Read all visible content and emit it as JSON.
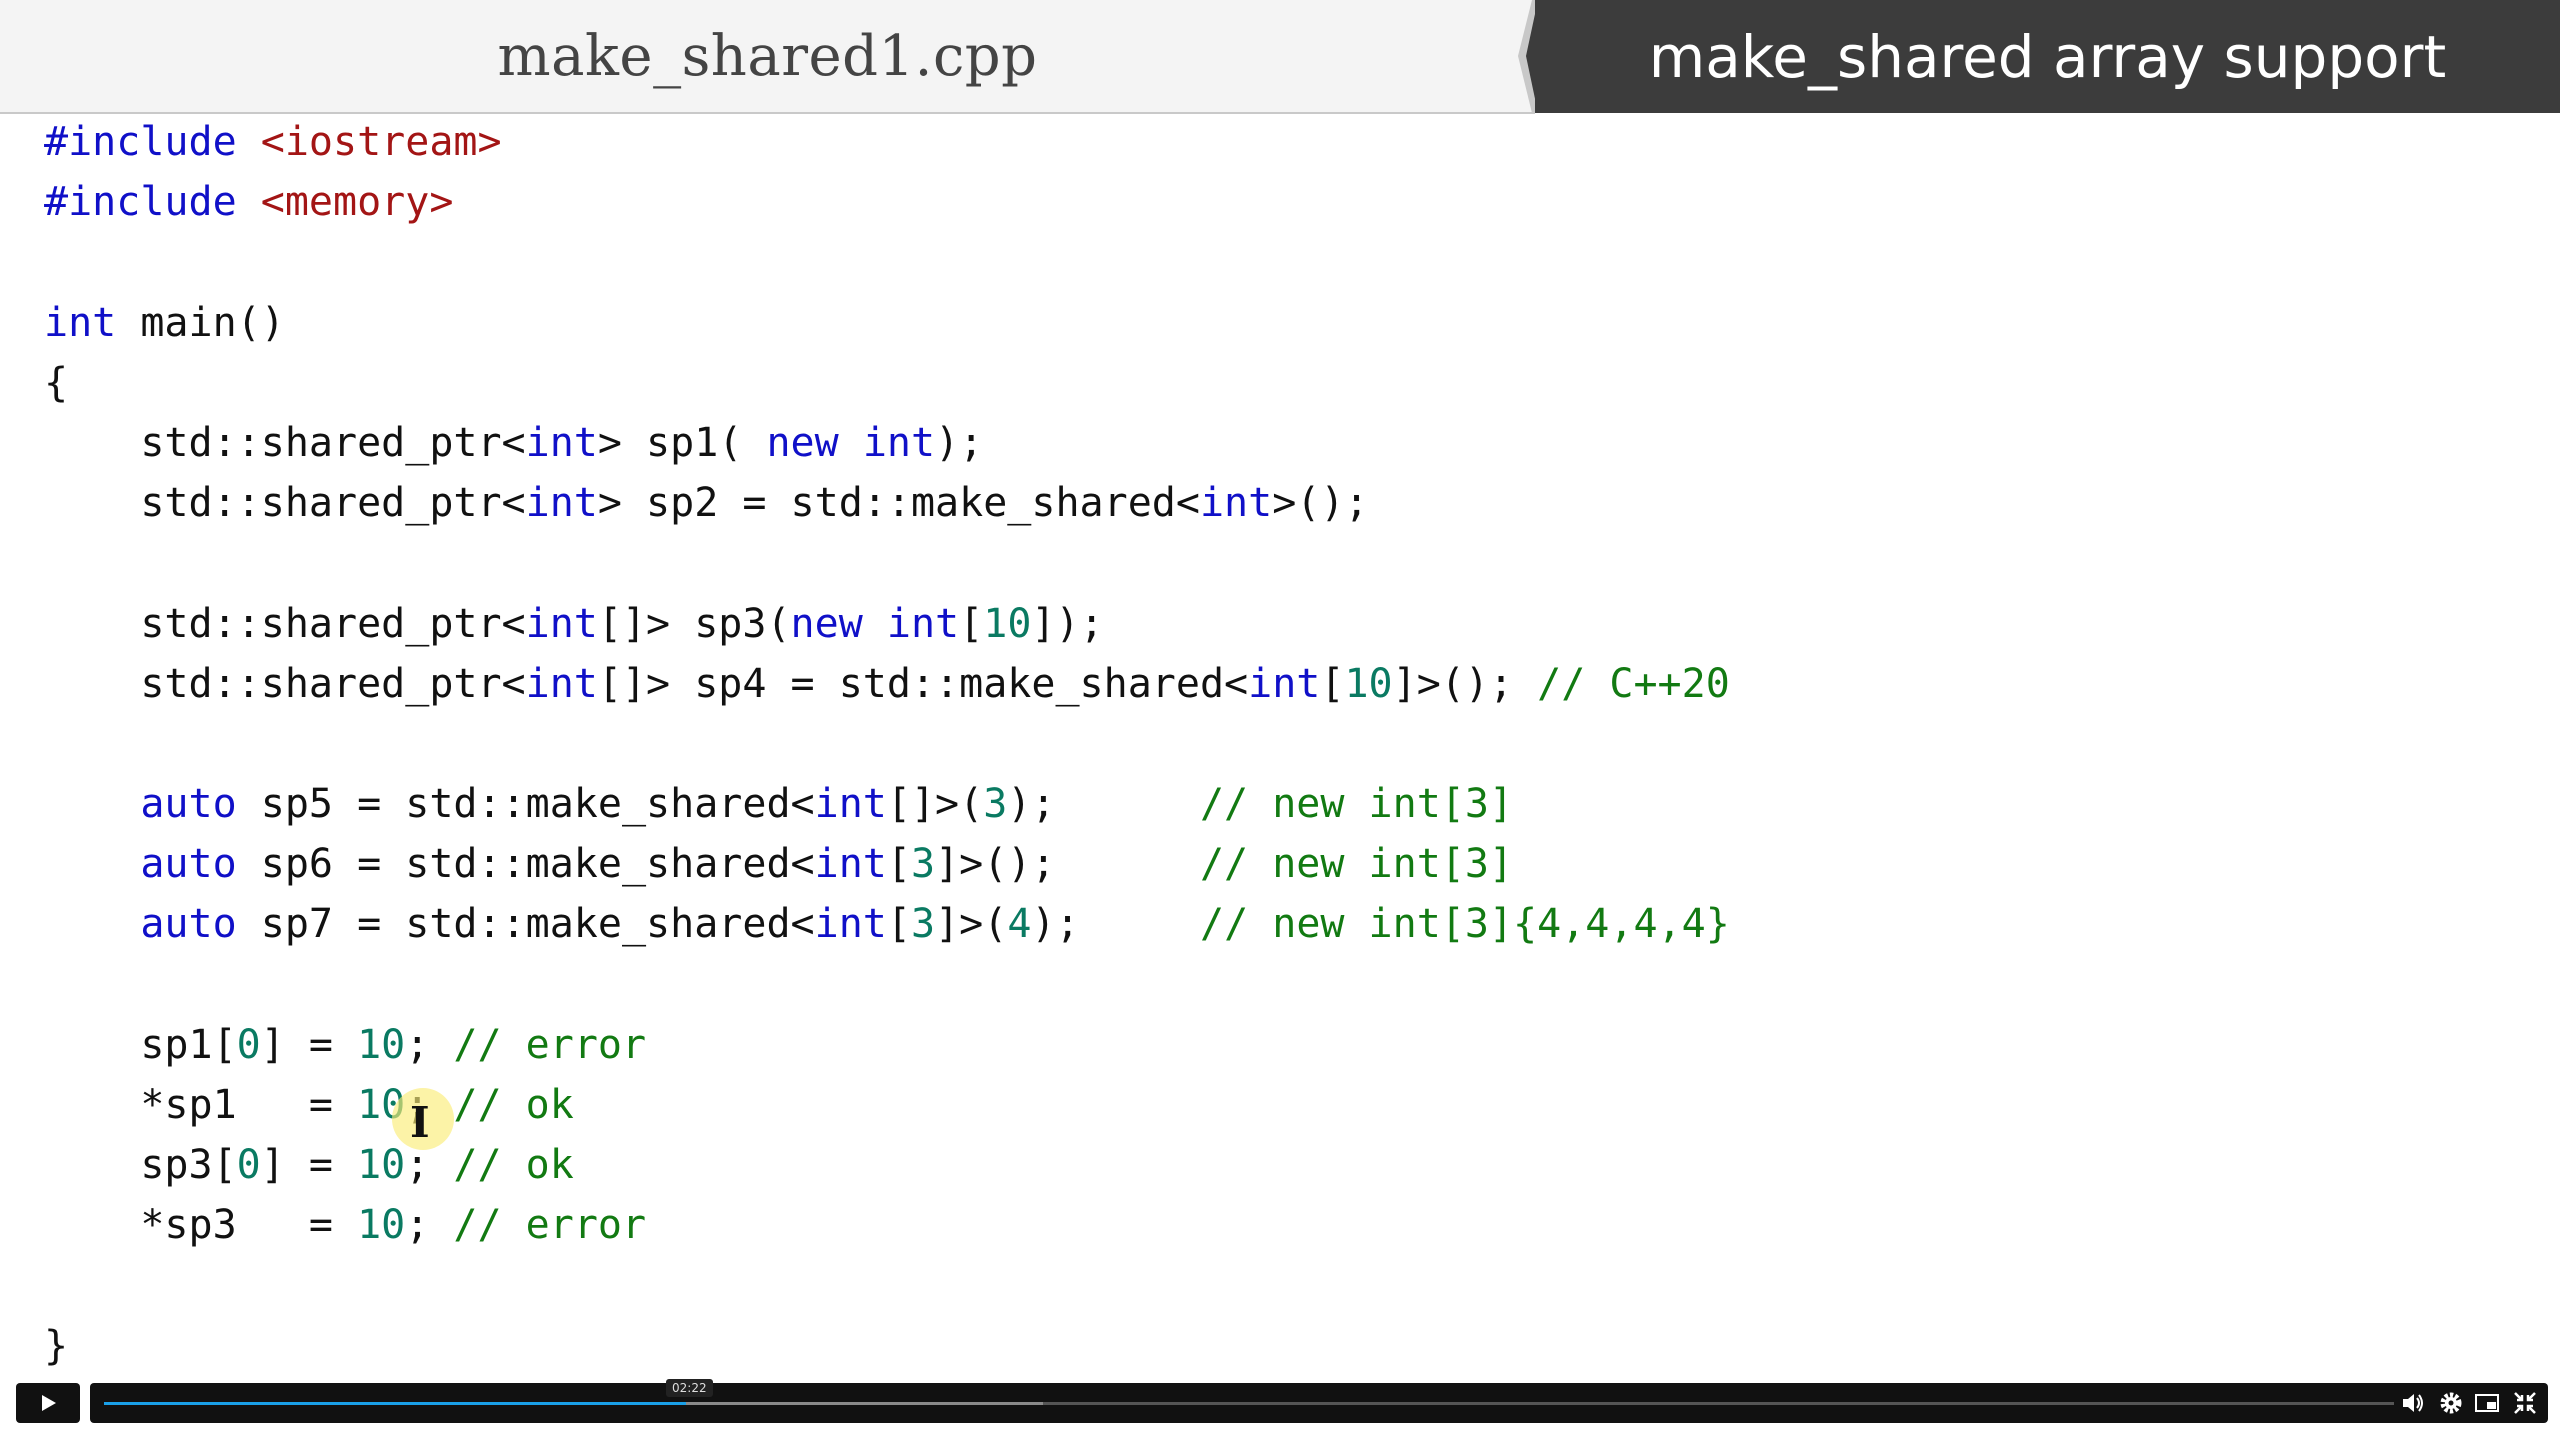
{
  "header": {
    "file_name": "make_shared1.cpp",
    "topic_title": "make_shared array support"
  },
  "code_lines": [
    [
      {
        "t": "#include ",
        "c": "k"
      },
      {
        "t": "<iostream>",
        "c": "s"
      }
    ],
    [
      {
        "t": "#include ",
        "c": "k"
      },
      {
        "t": "<memory>",
        "c": "s"
      }
    ],
    [],
    [
      {
        "t": "int",
        "c": "k"
      },
      {
        "t": " main()",
        "c": "p"
      }
    ],
    [
      {
        "t": "{",
        "c": "p"
      }
    ],
    [
      {
        "t": "    std::shared_ptr<",
        "c": "p"
      },
      {
        "t": "int",
        "c": "k"
      },
      {
        "t": "> sp1( ",
        "c": "p"
      },
      {
        "t": "new",
        "c": "k"
      },
      {
        "t": " ",
        "c": "p"
      },
      {
        "t": "int",
        "c": "k"
      },
      {
        "t": ");",
        "c": "p"
      }
    ],
    [
      {
        "t": "    std::shared_ptr<",
        "c": "p"
      },
      {
        "t": "int",
        "c": "k"
      },
      {
        "t": "> sp2 = std::make_shared<",
        "c": "p"
      },
      {
        "t": "int",
        "c": "k"
      },
      {
        "t": ">();",
        "c": "p"
      }
    ],
    [],
    [
      {
        "t": "    std::shared_ptr<",
        "c": "p"
      },
      {
        "t": "int",
        "c": "k"
      },
      {
        "t": "[]> sp3(",
        "c": "p"
      },
      {
        "t": "new",
        "c": "k"
      },
      {
        "t": " ",
        "c": "p"
      },
      {
        "t": "int",
        "c": "k"
      },
      {
        "t": "[",
        "c": "p"
      },
      {
        "t": "10",
        "c": "n"
      },
      {
        "t": "]);",
        "c": "p"
      }
    ],
    [
      {
        "t": "    std::shared_ptr<",
        "c": "p"
      },
      {
        "t": "int",
        "c": "k"
      },
      {
        "t": "[]> sp4 = std::make_shared<",
        "c": "p"
      },
      {
        "t": "int",
        "c": "k"
      },
      {
        "t": "[",
        "c": "p"
      },
      {
        "t": "10",
        "c": "n"
      },
      {
        "t": "]>(); ",
        "c": "p"
      },
      {
        "t": "// C++20",
        "c": "c"
      }
    ],
    [],
    [
      {
        "t": "    ",
        "c": "p"
      },
      {
        "t": "auto",
        "c": "k"
      },
      {
        "t": " sp5 = std::make_shared<",
        "c": "p"
      },
      {
        "t": "int",
        "c": "k"
      },
      {
        "t": "[]>(",
        "c": "p"
      },
      {
        "t": "3",
        "c": "n"
      },
      {
        "t": ");      ",
        "c": "p"
      },
      {
        "t": "// new int[3]",
        "c": "c"
      }
    ],
    [
      {
        "t": "    ",
        "c": "p"
      },
      {
        "t": "auto",
        "c": "k"
      },
      {
        "t": " sp6 = std::make_shared<",
        "c": "p"
      },
      {
        "t": "int",
        "c": "k"
      },
      {
        "t": "[",
        "c": "p"
      },
      {
        "t": "3",
        "c": "n"
      },
      {
        "t": "]>();      ",
        "c": "p"
      },
      {
        "t": "// new int[3]",
        "c": "c"
      }
    ],
    [
      {
        "t": "    ",
        "c": "p"
      },
      {
        "t": "auto",
        "c": "k"
      },
      {
        "t": " sp7 = std::make_shared<",
        "c": "p"
      },
      {
        "t": "int",
        "c": "k"
      },
      {
        "t": "[",
        "c": "p"
      },
      {
        "t": "3",
        "c": "n"
      },
      {
        "t": "]>(",
        "c": "p"
      },
      {
        "t": "4",
        "c": "n"
      },
      {
        "t": ");     ",
        "c": "p"
      },
      {
        "t": "// new int[3]{4,4,4,4}",
        "c": "c"
      }
    ],
    [],
    [
      {
        "t": "    sp1[",
        "c": "p"
      },
      {
        "t": "0",
        "c": "n"
      },
      {
        "t": "] = ",
        "c": "p"
      },
      {
        "t": "10",
        "c": "n"
      },
      {
        "t": "; ",
        "c": "p"
      },
      {
        "t": "// error",
        "c": "c"
      }
    ],
    [
      {
        "t": "    *sp1   = ",
        "c": "p"
      },
      {
        "t": "10",
        "c": "n"
      },
      {
        "t": "; ",
        "c": "p"
      },
      {
        "t": "// ok",
        "c": "c"
      }
    ],
    [
      {
        "t": "    sp3[",
        "c": "p"
      },
      {
        "t": "0",
        "c": "n"
      },
      {
        "t": "] = ",
        "c": "p"
      },
      {
        "t": "10",
        "c": "n"
      },
      {
        "t": "; ",
        "c": "p"
      },
      {
        "t": "// ok",
        "c": "c"
      }
    ],
    [
      {
        "t": "    *sp3   = ",
        "c": "p"
      },
      {
        "t": "10",
        "c": "n"
      },
      {
        "t": "; ",
        "c": "p"
      },
      {
        "t": "// error",
        "c": "c"
      }
    ],
    [],
    [
      {
        "t": "}",
        "c": "p"
      }
    ]
  ],
  "player": {
    "current_time": "02:22",
    "progress_fraction": 0.254,
    "buffered_fraction": 0.41,
    "colors": {
      "progress": "#1aa0e8",
      "bar": "#111111"
    },
    "icons": [
      "play-icon",
      "volume-icon",
      "gear-icon",
      "pip-icon",
      "exit-fullscreen-icon"
    ]
  }
}
